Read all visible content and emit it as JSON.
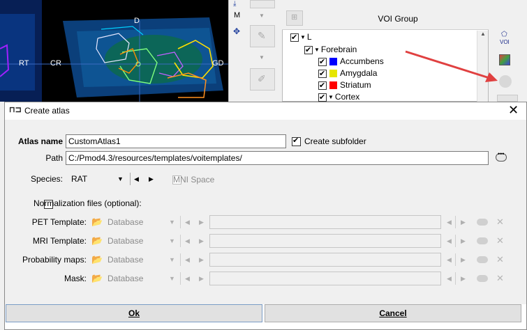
{
  "background": {
    "image_labels": {
      "left_rt": "RT",
      "cr": "CR",
      "d": "D",
      "gd": "GD"
    },
    "toolbar": {
      "m_label": "M"
    },
    "voi_panel": {
      "title": "VOI Group",
      "voi_icon_label": "VOI",
      "tree": [
        {
          "label": "L",
          "level": 0
        },
        {
          "label": "Forebrain",
          "level": 1
        },
        {
          "label": "Accumbens",
          "level": 2,
          "color": "#0000ff"
        },
        {
          "label": "Amygdala",
          "level": 2,
          "color": "#e6e600"
        },
        {
          "label": "Striatum",
          "level": 2,
          "color": "#ff0000"
        },
        {
          "label": "Cortex",
          "level": 2
        }
      ]
    }
  },
  "dialog": {
    "title": "Create atlas",
    "atlas_name_label": "Atlas name",
    "atlas_name_value": "CustomAtlas1",
    "create_subfolder_label": "Create subfolder",
    "create_subfolder_checked": true,
    "path_label": "Path",
    "path_value": "C:/Pmod4.3/resources/templates/voitemplates/",
    "species_label": "Species:",
    "species_value": "RAT",
    "mni_space_label": "MNI Space",
    "normalization_label": "Normalization files (optional):",
    "rows": [
      {
        "label": "PET Template:",
        "source": "Database"
      },
      {
        "label": "MRI Template:",
        "source": "Database"
      },
      {
        "label": "Probability maps:",
        "source": "Database"
      },
      {
        "label": "Mask:",
        "source": "Database"
      }
    ],
    "ok_label": "Ok",
    "cancel_label": "Cancel"
  },
  "colors": {
    "accent_arrow": "#e04040"
  }
}
